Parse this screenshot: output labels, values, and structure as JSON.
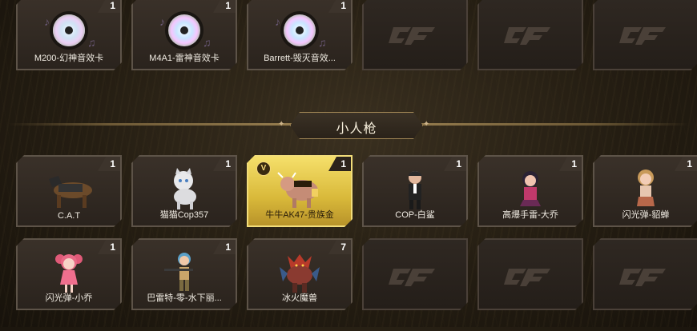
{
  "section": {
    "title": "小人枪"
  },
  "rows": [
    [
      {
        "name": "M200-幻神音效卡",
        "count": "1",
        "icon": "music-disc-icon"
      },
      {
        "name": "M4A1-雷神音效卡",
        "count": "1",
        "icon": "music-disc-icon"
      },
      {
        "name": "Barrett-毁灭音效...",
        "count": "1",
        "icon": "music-disc-icon"
      },
      {
        "empty": true,
        "icon": "cf-logo-icon"
      },
      {
        "empty": true,
        "icon": "cf-logo-icon"
      },
      {
        "empty": true,
        "icon": "cf-logo-icon"
      }
    ],
    [
      {
        "name": "C.A.T",
        "count": "1",
        "icon": "cat-figure-icon"
      },
      {
        "name": "猫猫Cop357",
        "count": "1",
        "icon": "cat-cop-figure-icon"
      },
      {
        "name": "牛牛AK47-贵族金",
        "count": "1",
        "icon": "bull-figure-icon",
        "gold": true,
        "badge": "V"
      },
      {
        "name": "COP-白鲨",
        "count": "1",
        "icon": "agent-figure-icon"
      },
      {
        "name": "高爆手雷-大乔",
        "count": "1",
        "icon": "girl-figure-icon"
      },
      {
        "name": "闪光弹-貂蝉",
        "count": "1",
        "icon": "girl-figure-icon"
      }
    ],
    [
      {
        "name": "闪光弹-小乔",
        "count": "1",
        "icon": "pink-girl-figure-icon"
      },
      {
        "name": "巴雷特-零-水下丽...",
        "count": "1",
        "icon": "soldier-figure-icon"
      },
      {
        "name": "冰火魔兽",
        "count": "7",
        "icon": "beast-figure-icon"
      },
      {
        "empty": true,
        "icon": "cf-logo-icon"
      },
      {
        "empty": true,
        "icon": "cf-logo-icon"
      },
      {
        "empty": true,
        "icon": "cf-logo-icon"
      }
    ]
  ]
}
